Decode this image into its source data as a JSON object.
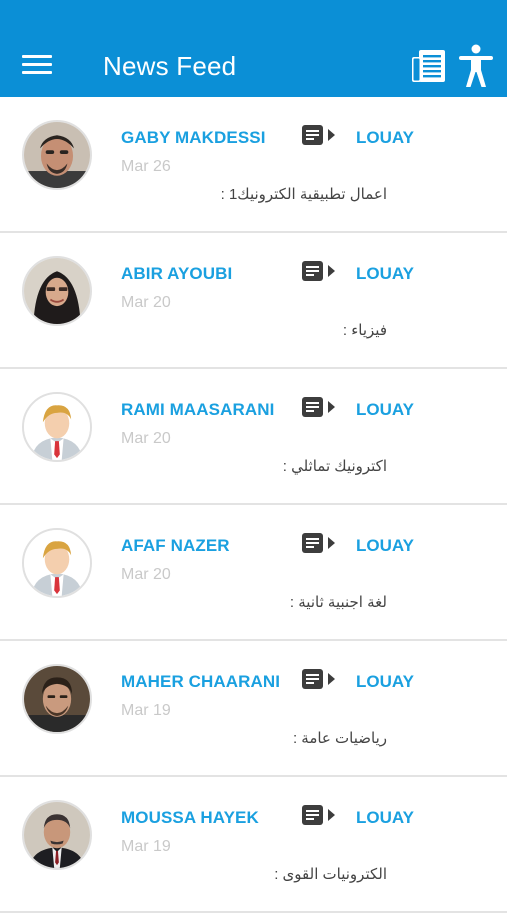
{
  "header": {
    "title": "News Feed",
    "menu_icon": "hamburger-menu-icon",
    "feed_icon": "newspaper-icon",
    "accessibility_icon": "accessibility-person-icon",
    "color": "#0b8fd6"
  },
  "feed": {
    "items": [
      {
        "author": "GABY MAKDESSI",
        "date": "Mar 26",
        "target": "LOUAY",
        "subject": "اعمال تطبيقية الكترونيك1 :",
        "avatar": "photo"
      },
      {
        "author": "ABIR AYOUBI",
        "date": "Mar 20",
        "target": "LOUAY",
        "subject": "فيزياء :",
        "avatar": "photo"
      },
      {
        "author": "RAMI MAASARANI",
        "date": "Mar 20",
        "target": "LOUAY",
        "subject": "اكترونيك تماثلي :",
        "avatar": "default"
      },
      {
        "author": "AFAF NAZER",
        "date": "Mar 20",
        "target": "LOUAY",
        "subject": "لغة اجنبية ثانية :",
        "avatar": "default"
      },
      {
        "author": "MAHER CHAARANI",
        "date": "Mar 19",
        "target": "LOUAY",
        "subject": "رياضيات عامة :",
        "avatar": "photo"
      },
      {
        "author": "MOUSSA HAYEK",
        "date": "Mar 19",
        "target": "LOUAY",
        "subject": "الكترونيات القوى :",
        "avatar": "photo"
      }
    ]
  },
  "colors": {
    "accent": "#1aa0e0",
    "date": "#c9c9c9",
    "divider": "#e3e3e3"
  }
}
